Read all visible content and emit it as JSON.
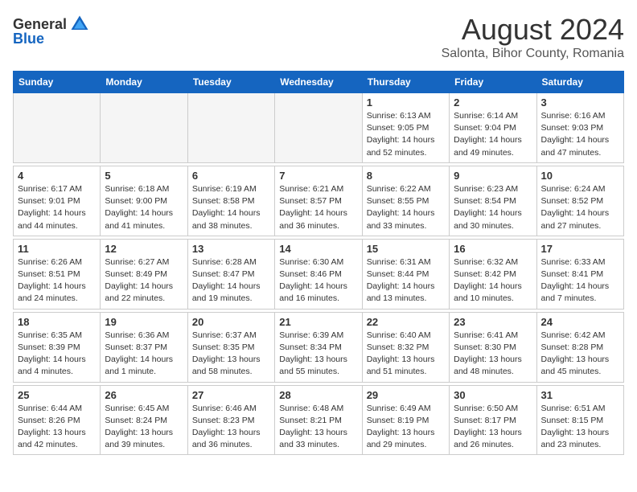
{
  "logo": {
    "general": "General",
    "blue": "Blue"
  },
  "title": "August 2024",
  "subtitle": "Salonta, Bihor County, Romania",
  "days_of_week": [
    "Sunday",
    "Monday",
    "Tuesday",
    "Wednesday",
    "Thursday",
    "Friday",
    "Saturday"
  ],
  "weeks": [
    [
      {
        "day": "",
        "info": ""
      },
      {
        "day": "",
        "info": ""
      },
      {
        "day": "",
        "info": ""
      },
      {
        "day": "",
        "info": ""
      },
      {
        "day": "1",
        "info": "Sunrise: 6:13 AM\nSunset: 9:05 PM\nDaylight: 14 hours and 52 minutes."
      },
      {
        "day": "2",
        "info": "Sunrise: 6:14 AM\nSunset: 9:04 PM\nDaylight: 14 hours and 49 minutes."
      },
      {
        "day": "3",
        "info": "Sunrise: 6:16 AM\nSunset: 9:03 PM\nDaylight: 14 hours and 47 minutes."
      }
    ],
    [
      {
        "day": "4",
        "info": "Sunrise: 6:17 AM\nSunset: 9:01 PM\nDaylight: 14 hours and 44 minutes."
      },
      {
        "day": "5",
        "info": "Sunrise: 6:18 AM\nSunset: 9:00 PM\nDaylight: 14 hours and 41 minutes."
      },
      {
        "day": "6",
        "info": "Sunrise: 6:19 AM\nSunset: 8:58 PM\nDaylight: 14 hours and 38 minutes."
      },
      {
        "day": "7",
        "info": "Sunrise: 6:21 AM\nSunset: 8:57 PM\nDaylight: 14 hours and 36 minutes."
      },
      {
        "day": "8",
        "info": "Sunrise: 6:22 AM\nSunset: 8:55 PM\nDaylight: 14 hours and 33 minutes."
      },
      {
        "day": "9",
        "info": "Sunrise: 6:23 AM\nSunset: 8:54 PM\nDaylight: 14 hours and 30 minutes."
      },
      {
        "day": "10",
        "info": "Sunrise: 6:24 AM\nSunset: 8:52 PM\nDaylight: 14 hours and 27 minutes."
      }
    ],
    [
      {
        "day": "11",
        "info": "Sunrise: 6:26 AM\nSunset: 8:51 PM\nDaylight: 14 hours and 24 minutes."
      },
      {
        "day": "12",
        "info": "Sunrise: 6:27 AM\nSunset: 8:49 PM\nDaylight: 14 hours and 22 minutes."
      },
      {
        "day": "13",
        "info": "Sunrise: 6:28 AM\nSunset: 8:47 PM\nDaylight: 14 hours and 19 minutes."
      },
      {
        "day": "14",
        "info": "Sunrise: 6:30 AM\nSunset: 8:46 PM\nDaylight: 14 hours and 16 minutes."
      },
      {
        "day": "15",
        "info": "Sunrise: 6:31 AM\nSunset: 8:44 PM\nDaylight: 14 hours and 13 minutes."
      },
      {
        "day": "16",
        "info": "Sunrise: 6:32 AM\nSunset: 8:42 PM\nDaylight: 14 hours and 10 minutes."
      },
      {
        "day": "17",
        "info": "Sunrise: 6:33 AM\nSunset: 8:41 PM\nDaylight: 14 hours and 7 minutes."
      }
    ],
    [
      {
        "day": "18",
        "info": "Sunrise: 6:35 AM\nSunset: 8:39 PM\nDaylight: 14 hours and 4 minutes."
      },
      {
        "day": "19",
        "info": "Sunrise: 6:36 AM\nSunset: 8:37 PM\nDaylight: 14 hours and 1 minute."
      },
      {
        "day": "20",
        "info": "Sunrise: 6:37 AM\nSunset: 8:35 PM\nDaylight: 13 hours and 58 minutes."
      },
      {
        "day": "21",
        "info": "Sunrise: 6:39 AM\nSunset: 8:34 PM\nDaylight: 13 hours and 55 minutes."
      },
      {
        "day": "22",
        "info": "Sunrise: 6:40 AM\nSunset: 8:32 PM\nDaylight: 13 hours and 51 minutes."
      },
      {
        "day": "23",
        "info": "Sunrise: 6:41 AM\nSunset: 8:30 PM\nDaylight: 13 hours and 48 minutes."
      },
      {
        "day": "24",
        "info": "Sunrise: 6:42 AM\nSunset: 8:28 PM\nDaylight: 13 hours and 45 minutes."
      }
    ],
    [
      {
        "day": "25",
        "info": "Sunrise: 6:44 AM\nSunset: 8:26 PM\nDaylight: 13 hours and 42 minutes."
      },
      {
        "day": "26",
        "info": "Sunrise: 6:45 AM\nSunset: 8:24 PM\nDaylight: 13 hours and 39 minutes."
      },
      {
        "day": "27",
        "info": "Sunrise: 6:46 AM\nSunset: 8:23 PM\nDaylight: 13 hours and 36 minutes."
      },
      {
        "day": "28",
        "info": "Sunrise: 6:48 AM\nSunset: 8:21 PM\nDaylight: 13 hours and 33 minutes."
      },
      {
        "day": "29",
        "info": "Sunrise: 6:49 AM\nSunset: 8:19 PM\nDaylight: 13 hours and 29 minutes."
      },
      {
        "day": "30",
        "info": "Sunrise: 6:50 AM\nSunset: 8:17 PM\nDaylight: 13 hours and 26 minutes."
      },
      {
        "day": "31",
        "info": "Sunrise: 6:51 AM\nSunset: 8:15 PM\nDaylight: 13 hours and 23 minutes."
      }
    ]
  ]
}
